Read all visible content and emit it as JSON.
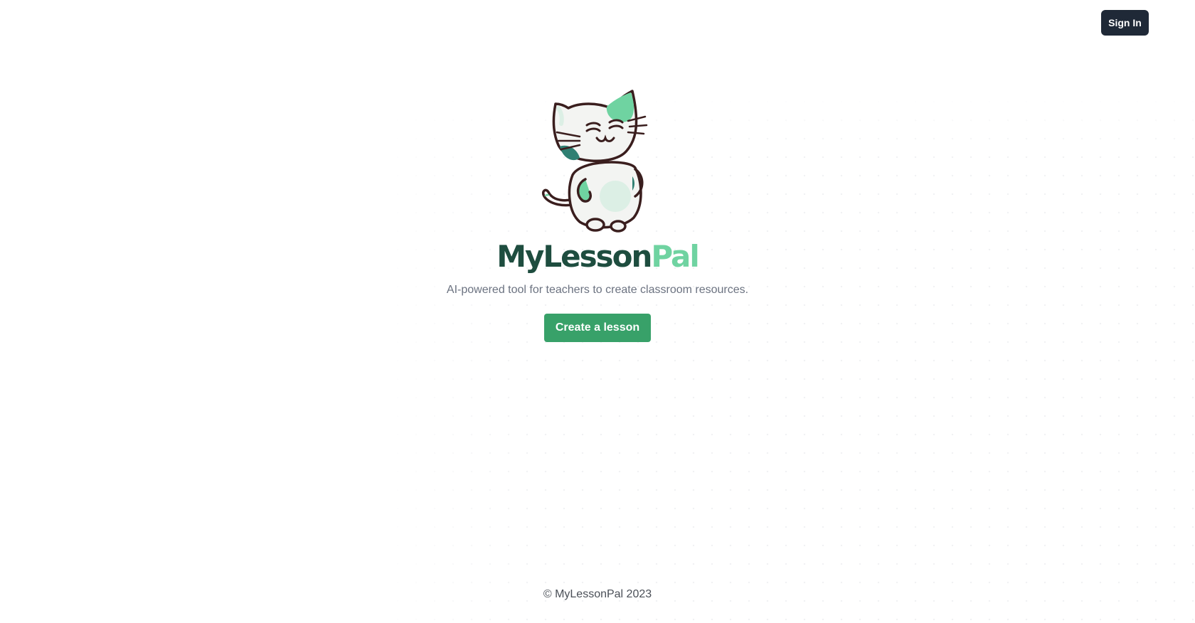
{
  "header": {
    "sign_in_label": "Sign In"
  },
  "hero": {
    "logo_icon": "cat-mascot-icon",
    "brand_part1": "MyLesson",
    "brand_part2": "Pal",
    "tagline": "AI-powered tool for teachers to create classroom resources.",
    "cta_label": "Create a lesson"
  },
  "footer": {
    "copyright": "© MyLessonPal 2023"
  },
  "colors": {
    "brand_dark": "#1e4d3f",
    "brand_light": "#6fd3a1",
    "cta": "#38a169",
    "sign_in_bg": "#1f2937"
  }
}
